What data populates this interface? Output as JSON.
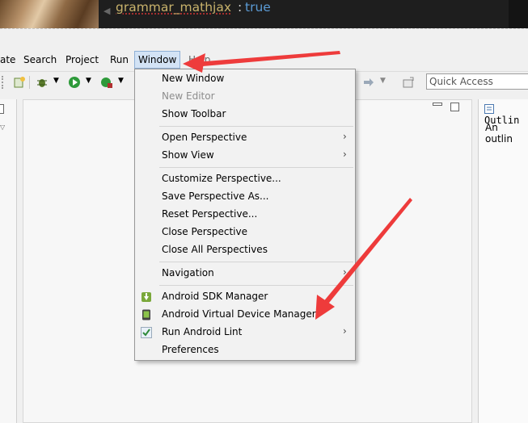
{
  "banner": {
    "key_text": "grammar_mathjax",
    "colon": ":",
    "value_text": "true"
  },
  "menubar": {
    "items": [
      "ate",
      "Search",
      "Project",
      "Run",
      "Window",
      "Help"
    ]
  },
  "toolbar": {
    "quick_access_placeholder": "Quick Access"
  },
  "right_panel": {
    "tab_label": "Outlin",
    "message": "An outlin"
  },
  "menu": {
    "items": [
      {
        "label": "New Window",
        "enabled": true
      },
      {
        "label": "New Editor",
        "enabled": false
      },
      {
        "label": "Show Toolbar",
        "enabled": true
      },
      {
        "label": "Open Perspective",
        "enabled": true,
        "submenu": true
      },
      {
        "label": "Show View",
        "enabled": true,
        "submenu": true
      },
      {
        "label": "Customize Perspective...",
        "enabled": true
      },
      {
        "label": "Save Perspective As...",
        "enabled": true
      },
      {
        "label": "Reset Perspective...",
        "enabled": true
      },
      {
        "label": "Close Perspective",
        "enabled": true
      },
      {
        "label": "Close All Perspectives",
        "enabled": true
      },
      {
        "label": "Navigation",
        "enabled": true,
        "submenu": true
      },
      {
        "label": "Android SDK Manager",
        "enabled": true,
        "icon": "android-sdk-icon"
      },
      {
        "label": "Android Virtual Device Manager",
        "enabled": true,
        "icon": "android-avd-icon"
      },
      {
        "label": "Run Android Lint",
        "enabled": true,
        "icon": "lint-check-icon",
        "submenu": true
      },
      {
        "label": "Preferences",
        "enabled": true
      }
    ],
    "submenu_glyph": "›"
  },
  "colors": {
    "annotation_arrow": "#ee3b3b",
    "menu_bg": "#f2f2f2",
    "menubar_active": "#d3e3f5"
  }
}
